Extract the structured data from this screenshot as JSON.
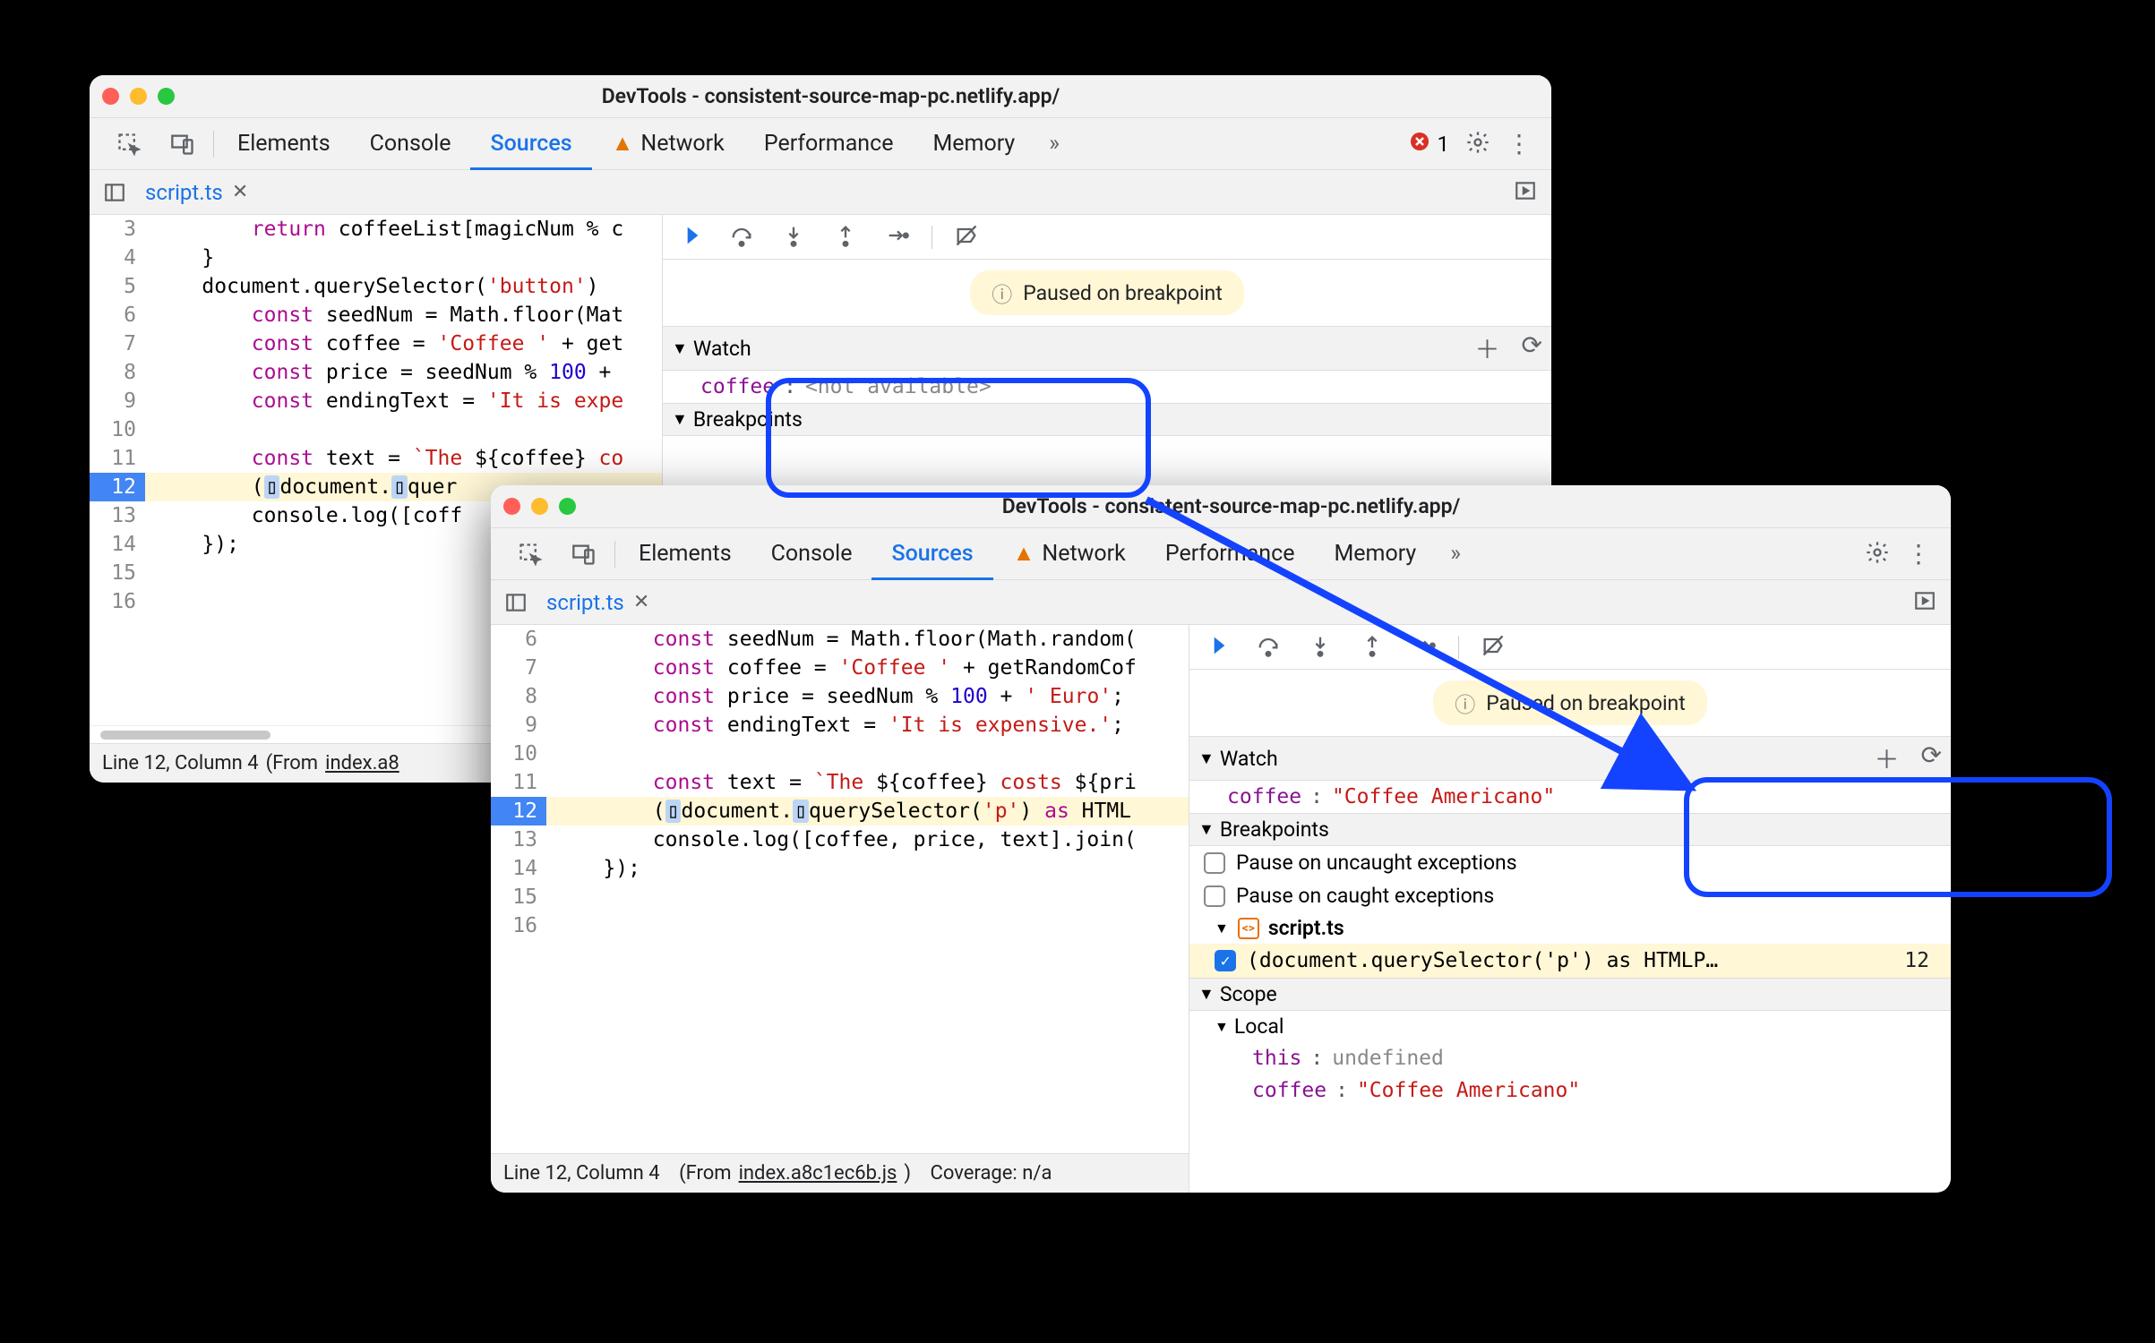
{
  "title_a": "DevTools - consistent-source-map-pc.netlify.app/",
  "title_b": "DevTools - consistent-source-map-pc.netlify.app/",
  "tabs": {
    "elements": "Elements",
    "console": "Console",
    "sources": "Sources",
    "network": "Network",
    "performance": "Performance",
    "memory": "Memory"
  },
  "error_count_a": "1",
  "file_tab": "script.ts",
  "paused_label": "Paused on breakpoint",
  "panes": {
    "watch": "Watch",
    "breakpoints": "Breakpoints",
    "bp_uncaught": "Pause on uncaught exceptions",
    "bp_caught": "Pause on caught exceptions",
    "scope": "Scope",
    "local": "Local"
  },
  "watch_a": {
    "name": "coffee",
    "value": "<not available>"
  },
  "watch_b": {
    "name": "coffee",
    "value": "\"Coffee Americano\""
  },
  "scope_b": {
    "this_label": "this",
    "this_val": "undefined",
    "coffee_label": "coffee",
    "coffee_val": "\"Coffee Americano\""
  },
  "bp_file": "script.ts",
  "bp_entry_text": "(document.querySelector('p') as HTMLP…",
  "bp_entry_line": "12",
  "status_a": {
    "pos": "Line 12, Column 4",
    "from_prefix": "(From ",
    "from_file": "index.a8"
  },
  "status_b": {
    "pos": "Line 12, Column 4",
    "from_prefix": "(From ",
    "from_file": "index.a8c1ec6b.js",
    "from_suffix": ")",
    "coverage": "Coverage: n/a"
  },
  "code_a": {
    "lines": [
      {
        "n": "3",
        "html": "        <span class='tok-kw'>return</span> coffeeList[magicNum % c"
      },
      {
        "n": "4",
        "html": "    }"
      },
      {
        "n": "5",
        "html": "    document.querySelector(<span class='tok-str'>'button'</span>)"
      },
      {
        "n": "6",
        "html": "        <span class='tok-kw'>const</span> seedNum = Math.floor(Mat"
      },
      {
        "n": "7",
        "html": "        <span class='tok-kw'>const</span> coffee = <span class='tok-str'>'Coffee '</span> + get"
      },
      {
        "n": "8",
        "html": "        <span class='tok-kw'>const</span> price = seedNum % <span class='tok-num'>100</span> + "
      },
      {
        "n": "9",
        "html": "        <span class='tok-kw'>const</span> endingText = <span class='tok-str'>'It is expe"
      },
      {
        "n": "10",
        "html": ""
      },
      {
        "n": "11",
        "html": "        <span class='tok-kw'>const</span> text = <span class='tok-tpl'>`The </span>${coffee}<span class='tok-tpl'> co"
      },
      {
        "n": "12",
        "hl": true,
        "html": "        (<span class='debug-mark'>▯</span>document.<span class='debug-mark'>▯</span>quer"
      },
      {
        "n": "13",
        "html": "        console.log([coff"
      },
      {
        "n": "14",
        "html": "    });"
      },
      {
        "n": "15",
        "html": ""
      },
      {
        "n": "16",
        "html": ""
      }
    ]
  },
  "code_b": {
    "lines": [
      {
        "n": "6",
        "html": "        <span class='tok-kw'>const</span> seedNum = Math.floor(Math.random("
      },
      {
        "n": "7",
        "html": "        <span class='tok-kw'>const</span> coffee = <span class='tok-str'>'Coffee '</span> + getRandomCof"
      },
      {
        "n": "8",
        "html": "        <span class='tok-kw'>const</span> price = seedNum % <span class='tok-num'>100</span> + <span class='tok-str'>' Euro'</span>;"
      },
      {
        "n": "9",
        "html": "        <span class='tok-kw'>const</span> endingText = <span class='tok-str'>'It is expensive.'</span>;"
      },
      {
        "n": "10",
        "html": ""
      },
      {
        "n": "11",
        "html": "        <span class='tok-kw'>const</span> text = <span class='tok-tpl'>`The </span>${coffee}<span class='tok-tpl'> costs </span>${pri"
      },
      {
        "n": "12",
        "hl": true,
        "html": "        (<span class='debug-mark'>▯</span>document.<span class='debug-mark'>▯</span>querySelector(<span class='tok-str'>'p'</span>) <span class='tok-kw'>as</span> HTML"
      },
      {
        "n": "13",
        "html": "        console.log([coffee, price, text].join("
      },
      {
        "n": "14",
        "html": "    });"
      },
      {
        "n": "15",
        "html": ""
      },
      {
        "n": "16",
        "html": ""
      }
    ]
  }
}
